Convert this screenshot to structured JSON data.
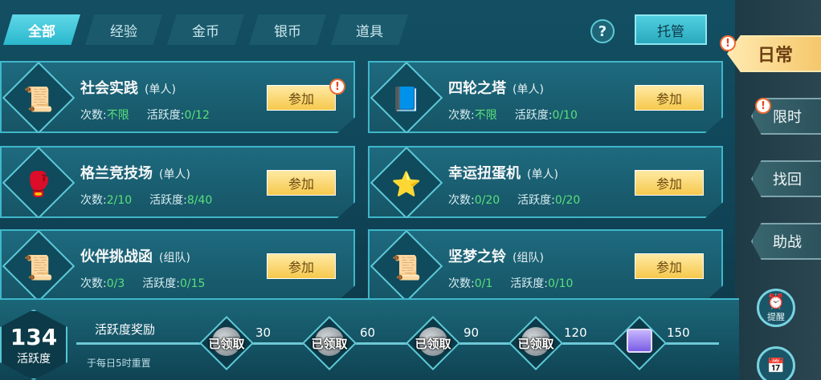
{
  "tabs": [
    "全部",
    "经验",
    "金币",
    "银币",
    "道具"
  ],
  "help_label": "?",
  "host_label": "托管",
  "side_tabs": [
    "日常",
    "限时",
    "找回",
    "助战"
  ],
  "side_round": [
    "提醒",
    ""
  ],
  "join_label": "参加",
  "stat_count_label": "次数:",
  "stat_activity_label": "活跃度:",
  "cards": [
    {
      "title": "社会实践",
      "mode": "(单人)",
      "count": "不限",
      "activity": "0/12",
      "icon": "scroll-icon",
      "alert": true
    },
    {
      "title": "四轮之塔",
      "mode": "(单人)",
      "count": "不限",
      "activity": "0/10",
      "icon": "book-icon",
      "alert": false
    },
    {
      "title": "格兰竞技场",
      "mode": "(单人)",
      "count": "2/10",
      "activity": "8/40",
      "icon": "gauntlet-icon",
      "alert": false
    },
    {
      "title": "幸运扭蛋机",
      "mode": "(单人)",
      "count": "0/20",
      "activity": "0/20",
      "icon": "capsule-icon",
      "alert": false
    },
    {
      "title": "伙伴挑战函",
      "mode": "(组队)",
      "count": "0/3",
      "activity": "0/15",
      "icon": "scroll-icon",
      "alert": false
    },
    {
      "title": "坚梦之铃",
      "mode": "(组队)",
      "count": "0/1",
      "activity": "0/10",
      "icon": "scroll-icon",
      "alert": false
    }
  ],
  "activity_score": "134",
  "activity_score_label": "活跃度",
  "reward_title": "活跃度奖励",
  "reset_note": "于每日5时重置",
  "rewards": [
    {
      "threshold": "30",
      "status": "已领取",
      "icon": "bag-icon"
    },
    {
      "threshold": "60",
      "status": "已领取",
      "icon": "bag-icon"
    },
    {
      "threshold": "90",
      "status": "已领取",
      "icon": "bag-icon"
    },
    {
      "threshold": "120",
      "status": "已领取",
      "icon": "bag-icon"
    },
    {
      "threshold": "150",
      "status": "",
      "icon": "chest-icon"
    }
  ]
}
